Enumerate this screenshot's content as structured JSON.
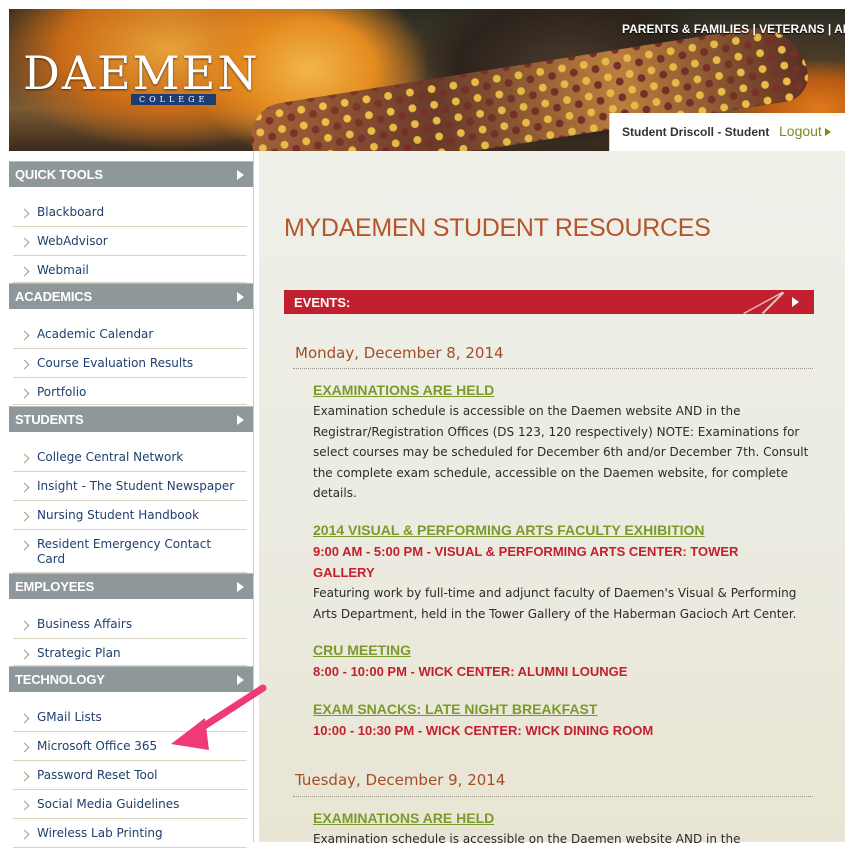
{
  "header": {
    "logo_main": "DAEMEN",
    "logo_sub": "COLLEGE",
    "top_links": "PARENTS & FAMILIES | VETERANS | ALU",
    "user_name": "Student Driscoll - Student",
    "logout_label": "Logout"
  },
  "sidebar": {
    "sections": [
      {
        "title": "QUICK TOOLS",
        "items": [
          "Blackboard",
          "WebAdvisor",
          "Webmail"
        ]
      },
      {
        "title": "ACADEMICS",
        "items": [
          "Academic Calendar",
          "Course Evaluation Results",
          "Portfolio"
        ]
      },
      {
        "title": "STUDENTS",
        "items": [
          "College Central Network",
          "Insight - The Student Newspaper",
          "Nursing Student Handbook",
          "Resident Emergency Contact Card"
        ]
      },
      {
        "title": "EMPLOYEES",
        "items": [
          "Business Affairs",
          "Strategic Plan"
        ]
      },
      {
        "title": "TECHNOLOGY",
        "items": [
          "GMail Lists",
          "Microsoft Office 365",
          "Password Reset Tool",
          "Social Media Guidelines",
          "Wireless Lab Printing"
        ]
      }
    ]
  },
  "main": {
    "page_title": "MYDAEMEN STUDENT RESOURCES",
    "events_label": "EVENTS:",
    "days": [
      {
        "date": "Monday, December 8, 2014",
        "events": [
          {
            "title": "EXAMINATIONS ARE HELD",
            "time": "",
            "desc": "Examination schedule is accessible on the Daemen website AND in the Registrar/Registration Offices (DS 123, 120 respectively) NOTE: Examinations for select courses may be scheduled for December 6th and/or December 7th. Consult the complete exam schedule, accessible on the Daemen website, for complete details."
          },
          {
            "title": "2014 VISUAL & PERFORMING ARTS FACULTY EXHIBITION",
            "time": "9:00 AM - 5:00 PM - VISUAL & PERFORMING ARTS CENTER: TOWER GALLERY",
            "desc": "Featuring work by full-time and adjunct faculty of Daemen's Visual & Performing Arts Department, held in the Tower Gallery of the Haberman Gacioch Art Center."
          },
          {
            "title": "CRU MEETING",
            "time": "8:00 - 10:00 PM - WICK CENTER: ALUMNI LOUNGE",
            "desc": ""
          },
          {
            "title": "EXAM SNACKS: LATE NIGHT BREAKFAST",
            "time": "10:00 - 10:30 PM - WICK CENTER: WICK DINING ROOM",
            "desc": ""
          }
        ]
      },
      {
        "date": "Tuesday, December 9, 2014",
        "events": [
          {
            "title": "EXAMINATIONS ARE HELD",
            "time": "",
            "desc": "Examination schedule is accessible on the Daemen website AND in the"
          }
        ]
      }
    ]
  },
  "annotation": {
    "color": "#ee3b78"
  }
}
